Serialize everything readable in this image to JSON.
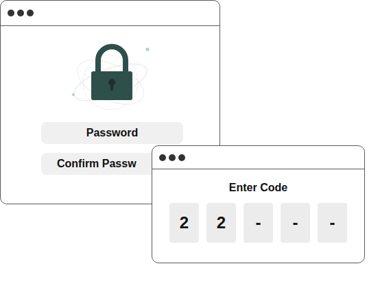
{
  "password_window": {
    "fields": [
      {
        "label": "Password",
        "cut": false
      },
      {
        "label": "Confirm Passw",
        "cut": true
      }
    ]
  },
  "code_window": {
    "title": "Enter Code",
    "digits": [
      "2",
      "2",
      "-",
      "-",
      "-"
    ]
  }
}
